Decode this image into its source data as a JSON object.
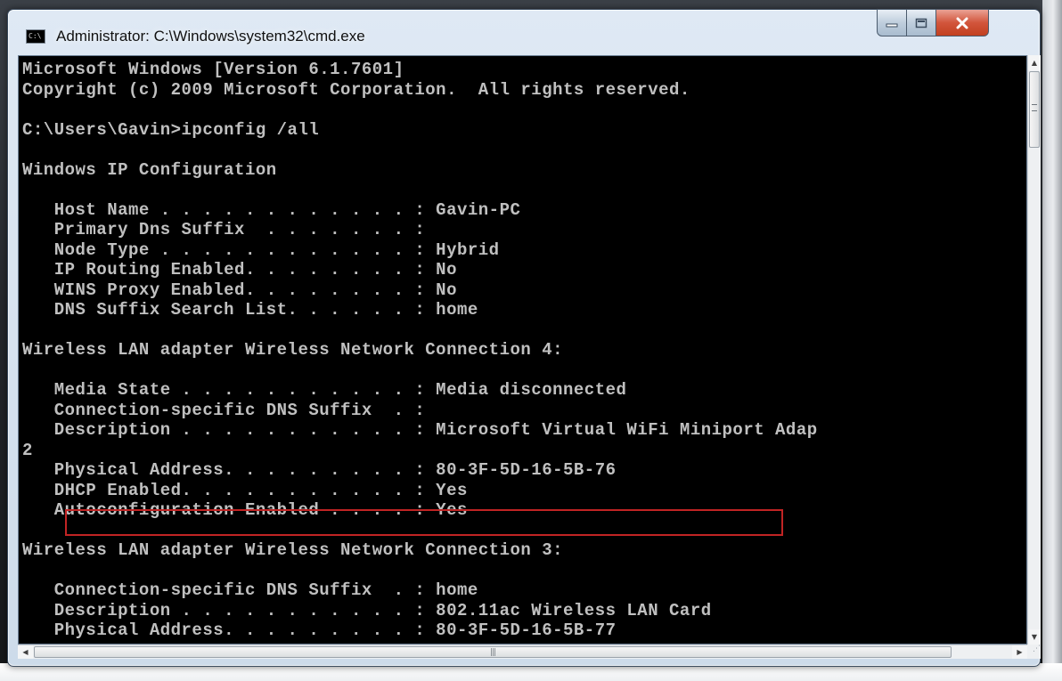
{
  "window": {
    "title": "Administrator: C:\\Windows\\system32\\cmd.exe",
    "icon_text": "C:\\",
    "controls": {
      "minimize": "minimize",
      "maximize": "maximize",
      "close": "close"
    }
  },
  "console": {
    "lines": [
      "Microsoft Windows [Version 6.1.7601]",
      "Copyright (c) 2009 Microsoft Corporation.  All rights reserved.",
      "",
      "C:\\Users\\Gavin>ipconfig /all",
      "",
      "Windows IP Configuration",
      "",
      "   Host Name . . . . . . . . . . . . : Gavin-PC",
      "   Primary Dns Suffix  . . . . . . . :",
      "   Node Type . . . . . . . . . . . . : Hybrid",
      "   IP Routing Enabled. . . . . . . . : No",
      "   WINS Proxy Enabled. . . . . . . . : No",
      "   DNS Suffix Search List. . . . . . : home",
      "",
      "Wireless LAN adapter Wireless Network Connection 4:",
      "",
      "   Media State . . . . . . . . . . . : Media disconnected",
      "   Connection-specific DNS Suffix  . :",
      "   Description . . . . . . . . . . . : Microsoft Virtual WiFi Miniport Adap",
      "2",
      "   Physical Address. . . . . . . . . : 80-3F-5D-16-5B-76",
      "   DHCP Enabled. . . . . . . . . . . : Yes",
      "   Autoconfiguration Enabled . . . . : Yes",
      "",
      "Wireless LAN adapter Wireless Network Connection 3:",
      "",
      "   Connection-specific DNS Suffix  . : home",
      "   Description . . . . . . . . . . . : 802.11ac Wireless LAN Card",
      "   Physical Address. . . . . . . . . : 80-3F-5D-16-5B-77"
    ],
    "highlighted_line": 20
  },
  "scrollbars": {
    "vertical_position": 0.08,
    "horizontal_position": 0.0
  },
  "colors": {
    "console_background": "#000000",
    "console_text": "#c0c0c0",
    "highlight_border": "#c12424",
    "close_button": "#c7462a"
  },
  "icons": {
    "app": "cmd-console-icon",
    "minimize": "minimize-icon",
    "maximize": "maximize-icon",
    "close": "close-icon",
    "scroll_up": "arrow-up-icon",
    "scroll_down": "arrow-down-icon",
    "scroll_left": "arrow-left-icon",
    "scroll_right": "arrow-right-icon"
  }
}
